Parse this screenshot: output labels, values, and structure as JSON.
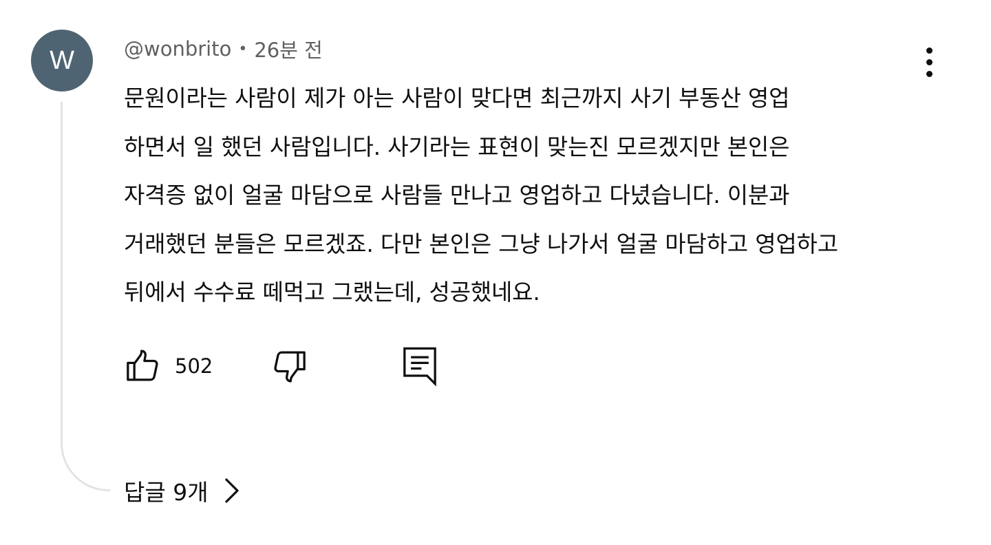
{
  "comment": {
    "avatar_letter": "W",
    "author": "@wonbrito",
    "separator": "•",
    "time": "26분 전",
    "lines": [
      "문원이라는 사람이 제가 아는 사람이 맞다면 최근까지 사기 부동산 영업",
      "하면서 일 했던 사람입니다. 사기라는 표현이 맞는진 모르겠지만 본인은",
      "자격증 없이 얼굴 마담으로 사람들 만나고 영업하고 다녔습니다. 이분과",
      "거래했던 분들은 모르겠죠. 다만 본인은 그냥 나가서 얼굴 마담하고 영업하고",
      "뒤에서 수수료 떼먹고 그랬는데, 성공했네요."
    ],
    "like_count": "502",
    "replies_label": "답글 9개"
  },
  "icons": {
    "more": "more-vertical-icon",
    "like": "thumbs-up-icon",
    "dislike": "thumbs-down-icon",
    "reply": "comment-reply-icon",
    "replies": "chevron-right-icon"
  },
  "colors": {
    "avatar_bg": "#4f6473",
    "meta_text": "#606060",
    "thread_line": "#e3e3e3"
  }
}
